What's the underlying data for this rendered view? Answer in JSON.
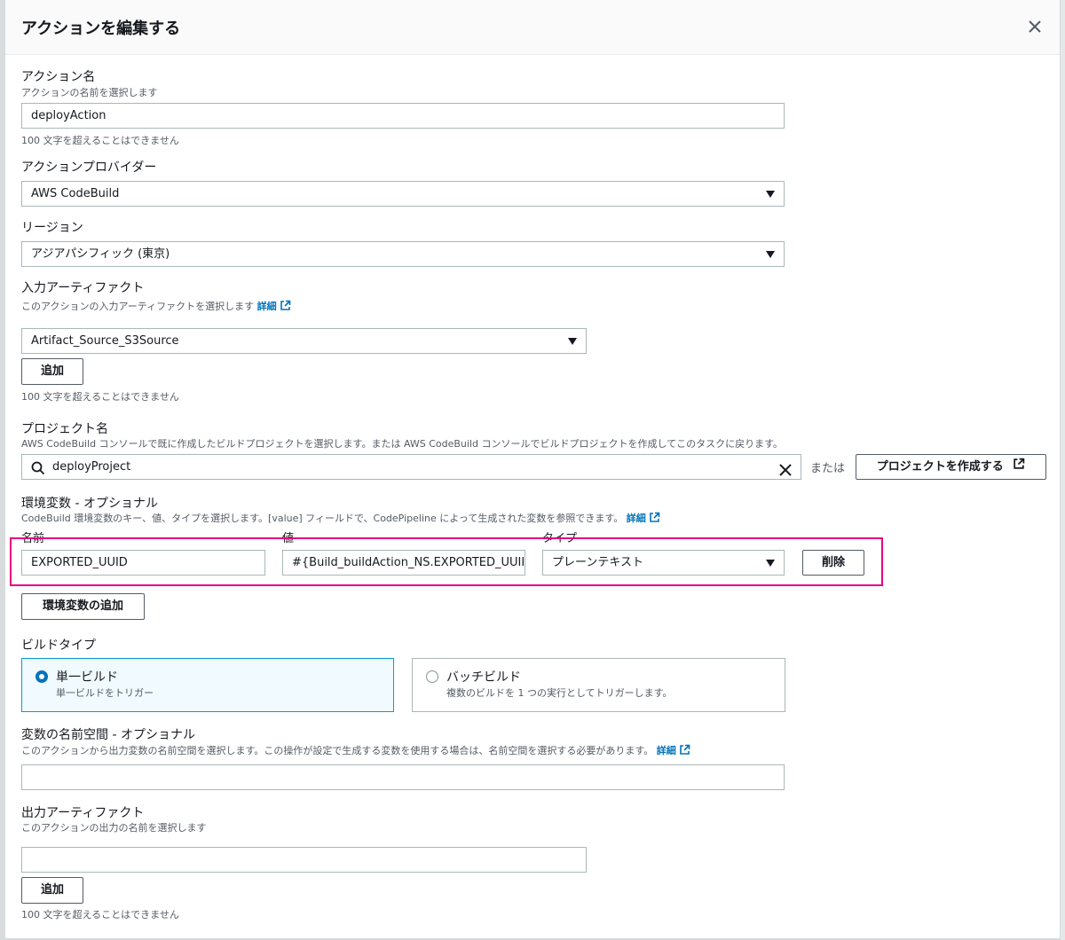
{
  "modal": {
    "title": "アクションを編集する"
  },
  "action_name": {
    "label": "アクション名",
    "description": "アクションの名前を選択します",
    "value": "deployAction",
    "constraint": "100 文字を超えることはできません"
  },
  "action_provider": {
    "label": "アクションプロバイダー",
    "value": "AWS CodeBuild"
  },
  "region": {
    "label": "リージョン",
    "value": "アジアパシフィック (東京)"
  },
  "input_artifacts": {
    "label": "入力アーティファクト",
    "description": "このアクションの入力アーティファクトを選択します",
    "link": "詳細",
    "value": "Artifact_Source_S3Source",
    "add_button": "追加",
    "constraint": "100 文字を超えることはできません"
  },
  "project_name": {
    "label": "プロジェクト名",
    "description": "AWS CodeBuild コンソールで既に作成したビルドプロジェクトを選択します。または AWS CodeBuild コンソールでビルドプロジェクトを作成してこのタスクに戻ります。",
    "value": "deployProject",
    "or_text": "または",
    "create_button": "プロジェクトを作成する"
  },
  "env_vars": {
    "label": "環境変数 - オプショナル",
    "description": "CodeBuild 環境変数のキー、値、タイプを選択します。[value] フィールドで、CodePipeline によって生成された変数を参照できます。",
    "link": "詳細",
    "col_name": "名前",
    "col_value": "値",
    "col_type": "タイプ",
    "rows": [
      {
        "name": "EXPORTED_UUID",
        "value": "#{Build_buildAction_NS.EXPORTED_UUII",
        "type": "プレーンテキスト",
        "delete_label": "削除"
      }
    ],
    "add_button": "環境変数の追加"
  },
  "build_type": {
    "label": "ビルドタイプ",
    "options": [
      {
        "title": "単一ビルド",
        "description": "単一ビルドをトリガー",
        "selected": true
      },
      {
        "title": "バッチビルド",
        "description": "複数のビルドを 1 つの実行としてトリガーします。",
        "selected": false
      }
    ]
  },
  "variable_namespace": {
    "label": "変数の名前空間 - オプショナル",
    "description": "このアクションから出力変数の名前空間を選択します。この操作が設定で生成する変数を使用する場合は、名前空間を選択する必要があります。",
    "link": "詳細",
    "value": ""
  },
  "output_artifacts": {
    "label": "出力アーティファクト",
    "description": "このアクションの出力の名前を選択します",
    "value": "",
    "add_button": "追加",
    "constraint": "100 文字を超えることはできません"
  },
  "colors": {
    "link": "#0073bb",
    "highlight": "#e6007e",
    "selected_border": "#00a1c9",
    "selected_bg": "#f1faff"
  }
}
